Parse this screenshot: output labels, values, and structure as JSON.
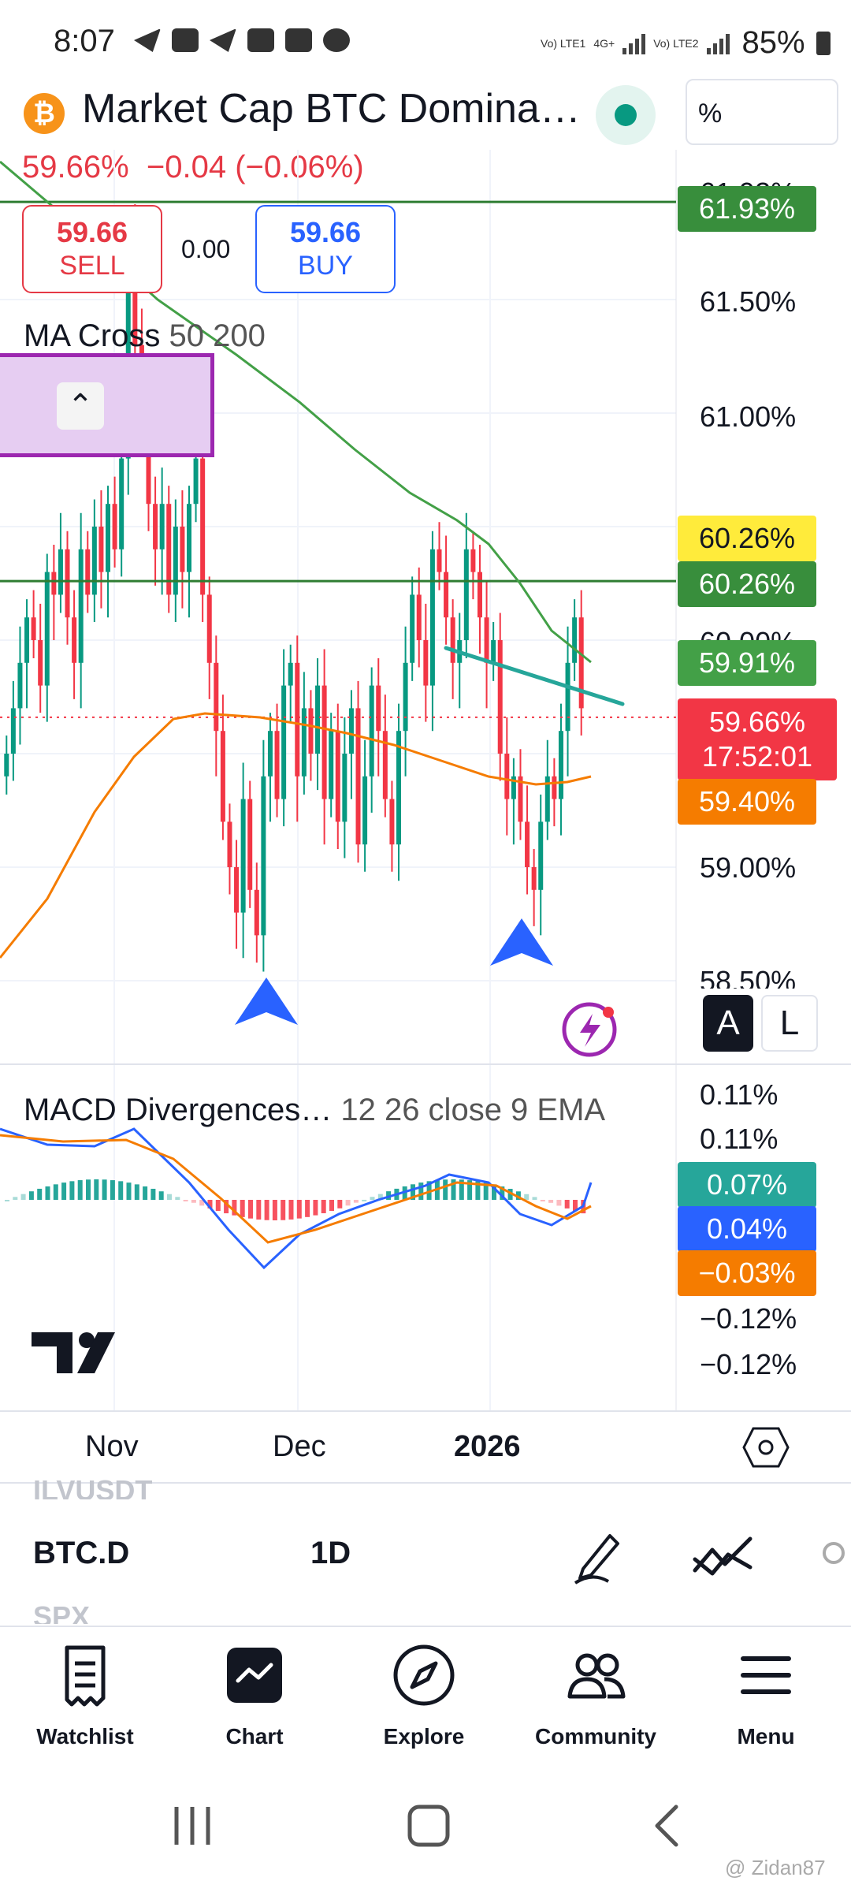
{
  "status_bar": {
    "time": "8:07",
    "network1": "Vo) LTE1",
    "network2": "4G+",
    "network3": "Vo) LTE2",
    "battery": "85%"
  },
  "header": {
    "title": "Market Cap BTC Domina…",
    "unit_button": "%",
    "price": "59.66%",
    "change": "−0.04 (−0.06%)"
  },
  "trade": {
    "sell_value": "59.66",
    "sell_label": "SELL",
    "spread": "0.00",
    "buy_value": "59.66",
    "buy_label": "BUY"
  },
  "indicators": {
    "ma_name": "MA Cross",
    "ma_params": "50 200",
    "macd_name": "MACD Divergences…",
    "macd_params": "12 26 close 9 EMA"
  },
  "price_axis": {
    "ticks": [
      "61.50%",
      "61.00%",
      "59.00%"
    ],
    "partial_ticks": [
      "60.00%",
      "58.50%",
      "61.93%"
    ]
  },
  "price_tags": {
    "line1": "61.93%",
    "yellow": "60.26%",
    "line2": "60.26%",
    "ma200": "59.91%",
    "last": "59.66%",
    "countdown": "17:52:01",
    "ma50": "59.40%"
  },
  "macd_axis": {
    "ticks": [
      "0.11%",
      "0.11%",
      "−0.12%",
      "−0.12%"
    ],
    "hist_tag": "0.07%",
    "macd_tag": "0.04%",
    "signal_tag": "−0.03%"
  },
  "scale_buttons": {
    "auto": "A",
    "log": "L"
  },
  "time_axis": {
    "labels": [
      "Nov",
      "Dec",
      "2026"
    ]
  },
  "toolbar": {
    "prev_symbol": "ILVUSDT",
    "symbol": "BTC.D",
    "interval": "1D",
    "next_symbol": "SPX"
  },
  "bottom_nav": [
    {
      "label": "Watchlist"
    },
    {
      "label": "Chart"
    },
    {
      "label": "Explore"
    },
    {
      "label": "Community"
    },
    {
      "label": "Menu"
    }
  ],
  "watermark": "@ Zidan87",
  "colors": {
    "up": "#089981",
    "down": "#f23645",
    "ma50": "#f57c00",
    "ma200": "#43a047",
    "hline": "#2e7d32",
    "trendline": "#26a69a",
    "marker": "#2962ff",
    "macd": "#2962ff",
    "signal": "#f57c00"
  },
  "chart_data": {
    "type": "candlestick",
    "symbol": "BTC.D",
    "interval": "1D",
    "ylim": [
      58.4,
      62.0
    ],
    "last_price": 59.66,
    "horizontal_lines": [
      61.93,
      60.26
    ],
    "ma50_last": 59.4,
    "ma200_last": 59.91,
    "markers": [
      "arrow-up (low of early Dec)",
      "arrow-up (low of early Jan)"
    ],
    "x_labels": [
      "Nov",
      "Dec",
      "2026"
    ]
  }
}
